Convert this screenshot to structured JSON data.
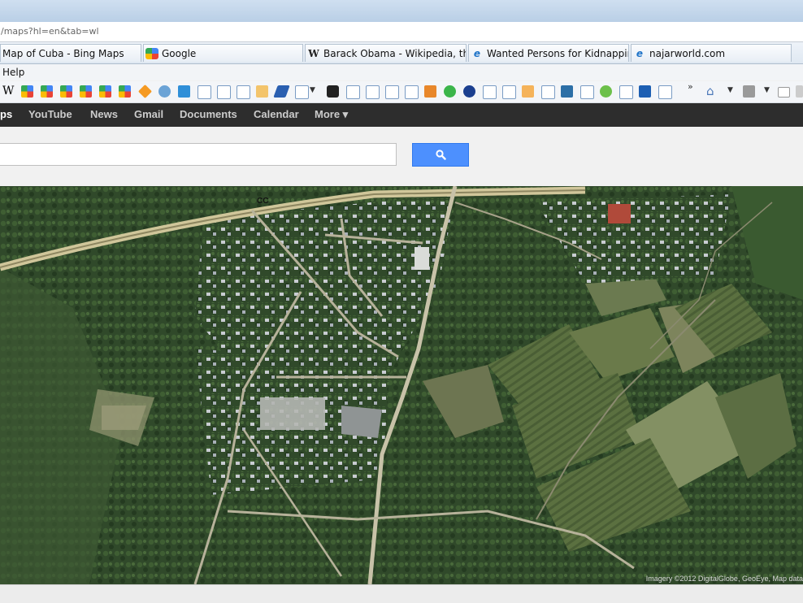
{
  "browser": {
    "url": "/maps?hl=en&tab=wl",
    "tabs": [
      {
        "label": "Map of Cuba - Bing Maps",
        "icon": "none"
      },
      {
        "label": "Google",
        "icon": "google-icon"
      },
      {
        "label": "Barack Obama - Wikipedia, th...",
        "icon": "wikipedia-icon"
      },
      {
        "label": "Wanted Persons for Kidnapping",
        "icon": "ie-page-icon"
      },
      {
        "label": "najarworld.com",
        "icon": "ie-page-icon"
      }
    ],
    "menu": {
      "help": "Help"
    },
    "favorites_overflow": "»"
  },
  "gbar": {
    "maps": "ps",
    "youtube": "YouTube",
    "news": "News",
    "gmail": "Gmail",
    "documents": "Documents",
    "calendar": "Calendar",
    "more": "More ▾"
  },
  "search": {
    "value": "",
    "button_icon": "search-icon"
  },
  "map": {
    "road_label": "CC",
    "attribution": "Imagery ©2012 DigitalGlobe, GeoEye, Map data",
    "colors": {
      "vegetation": "#2e4a26",
      "field": "#7b8a5a",
      "road": "#c8c2a8"
    }
  }
}
